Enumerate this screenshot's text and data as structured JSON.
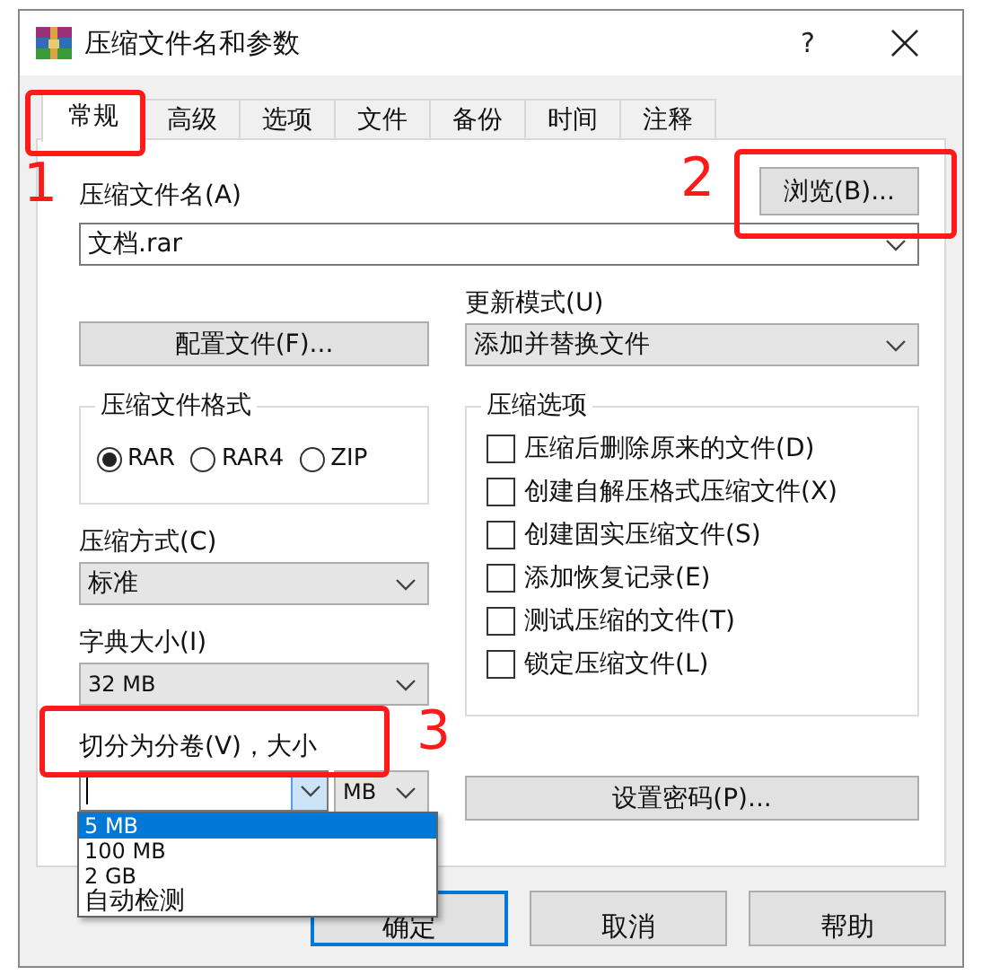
{
  "window": {
    "title": "压缩文件名和参数",
    "help_button": "?"
  },
  "tabs": [
    {
      "label": "常规",
      "selected": true,
      "callout": "1"
    },
    {
      "label": "高级",
      "selected": false
    },
    {
      "label": "选项",
      "selected": false
    },
    {
      "label": "文件",
      "selected": false
    },
    {
      "label": "备份",
      "selected": false
    },
    {
      "label": "时间",
      "selected": false
    },
    {
      "label": "注释",
      "selected": false
    }
  ],
  "archive_name": {
    "label": "压缩文件名(A)",
    "value": "文档.rar",
    "browse_button": "浏览(B)...",
    "browse_callout": "2"
  },
  "profiles_button": "配置文件(F)...",
  "update_mode": {
    "label": "更新模式(U)",
    "value": "添加并替换文件"
  },
  "archive_format": {
    "title": "压缩文件格式",
    "options": [
      {
        "label": "RAR",
        "selected": true
      },
      {
        "label": "RAR4",
        "selected": false
      },
      {
        "label": "ZIP",
        "selected": false
      }
    ]
  },
  "compression_method": {
    "label": "压缩方式(C)",
    "value": "标准"
  },
  "dictionary_size": {
    "label": "字典大小(I)",
    "value": "32 MB"
  },
  "split": {
    "label": "切分为分卷(V)，大小",
    "callout": "3",
    "unit": "MB",
    "expanded": true,
    "dropdown_items": [
      {
        "label": "5 MB",
        "selected": true
      },
      {
        "label": "100 MB",
        "selected": false
      },
      {
        "label": "2 GB",
        "selected": false
      },
      {
        "label": "自动检测",
        "selected": false
      }
    ]
  },
  "archive_options": {
    "title": "压缩选项",
    "items": [
      {
        "label": "压缩后删除原来的文件(D)",
        "checked": false
      },
      {
        "label": "创建自解压格式压缩文件(X)",
        "checked": false
      },
      {
        "label": "创建固实压缩文件(S)",
        "checked": false
      },
      {
        "label": "添加恢复记录(E)",
        "checked": false
      },
      {
        "label": "测试压缩的文件(T)",
        "checked": false
      },
      {
        "label": "锁定压缩文件(L)",
        "checked": false
      }
    ]
  },
  "set_password_button": "设置密码(P)...",
  "buttons": [
    {
      "label": "确定",
      "default": true
    },
    {
      "label": "取消",
      "default": false
    },
    {
      "label": "帮助",
      "default": false
    }
  ]
}
